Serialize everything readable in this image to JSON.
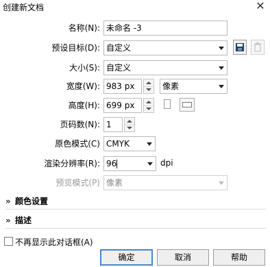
{
  "window": {
    "title": "创建新文档",
    "close_icon": "close-icon"
  },
  "form": {
    "name": {
      "label": "名称(N):",
      "value": "未命名 -3"
    },
    "preset": {
      "label": "预设目标(D):",
      "value": "自定义"
    },
    "size": {
      "label": "大小(S):",
      "value": "自定义"
    },
    "width": {
      "label": "宽度(W):",
      "value": "983 px",
      "unit": "像素"
    },
    "height": {
      "label": "高度(H):",
      "value": "699 px"
    },
    "pages": {
      "label": "页码数(N):",
      "value": "1"
    },
    "color_mode": {
      "label": "原色模式(C)",
      "value": "CMYK"
    },
    "resolution": {
      "label": "渲染分辨率(R):",
      "value": "96",
      "unit": "dpi"
    },
    "preview_mode": {
      "label": "预览模式(P)",
      "value": "像素"
    }
  },
  "sections": {
    "color_settings": "颜色设置",
    "description": "描述"
  },
  "footer": {
    "dont_show": "不再显示此对话框(A)",
    "ok": "确定",
    "cancel": "取消",
    "help": "帮助"
  },
  "colors": {
    "accent": "#4a86c7",
    "border": "#b9b9b9"
  }
}
